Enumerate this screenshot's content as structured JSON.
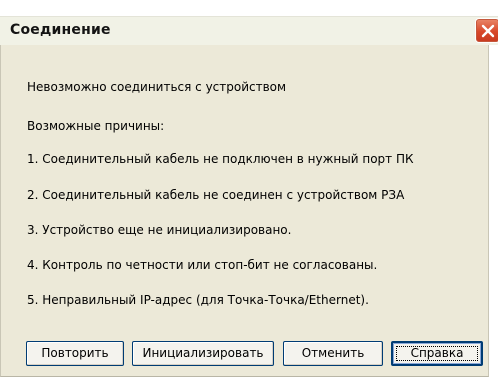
{
  "window": {
    "title": "Соединение"
  },
  "message": {
    "line1": "Невозможно соединиться с устройством",
    "line2": "Возможные причины:",
    "reasons": [
      "1. Соединительный кабель не подключен в нужный порт ПК",
      "2. Соединительный кабель не соединен с устройством РЗА",
      "3. Устройство еще не инициализировано.",
      "4. Контроль по четности или стоп-бит не согласованы.",
      "5. Неправильный IP-адрес (для Точка-Точка/Ethernet)."
    ]
  },
  "buttons": {
    "retry": "Повторить",
    "initialize": "Инициализировать",
    "cancel": "Отменить",
    "help": "Справка"
  },
  "colors": {
    "dialog_bg": "#ece9d8",
    "close_button": "#d8482a",
    "button_border": "#003c74"
  },
  "icons": {
    "close": "close-icon"
  }
}
